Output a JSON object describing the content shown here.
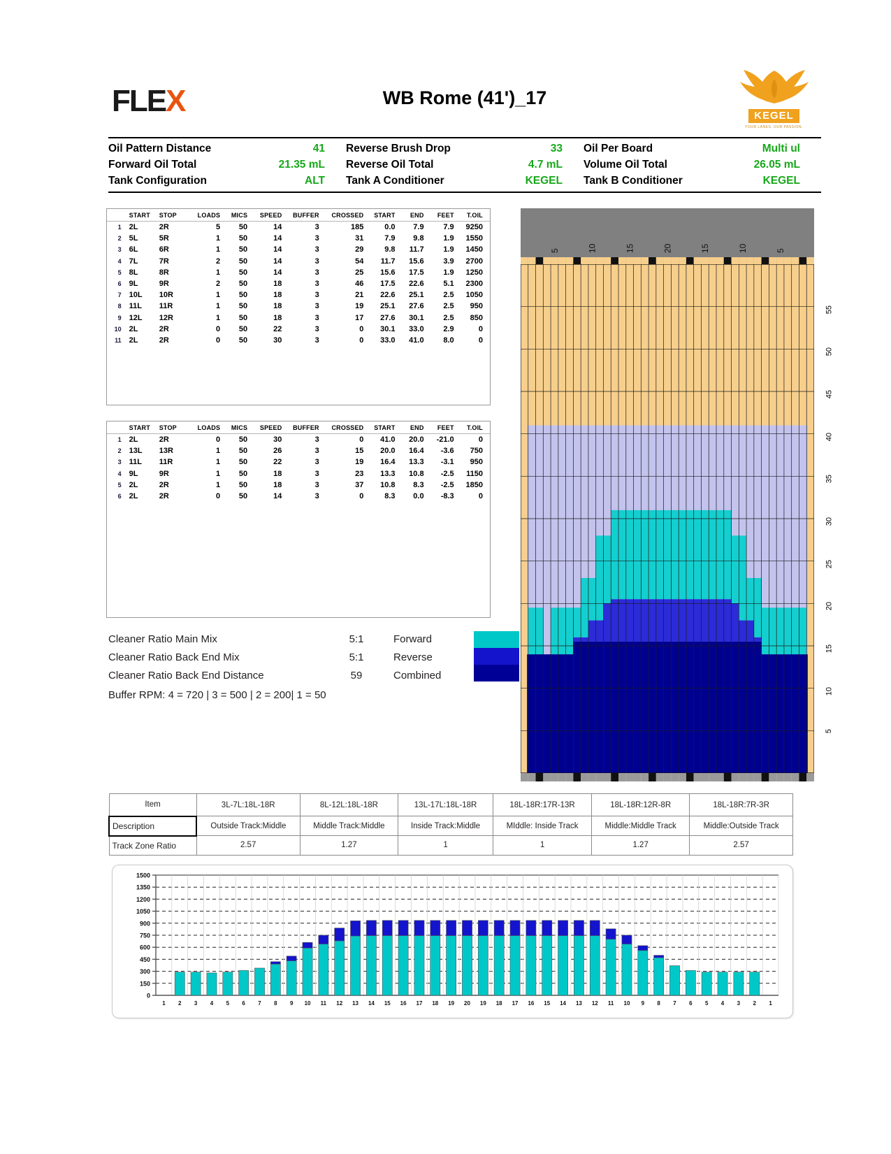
{
  "header": {
    "flex_logo_text": "FLEX",
    "title": "WB Rome (41')_17",
    "kegel_word": "KEGEL",
    "kegel_tagline": "YOUR LANES. OUR PASSION."
  },
  "summary": {
    "rows": [
      [
        {
          "label": "Oil Pattern Distance",
          "value": "41"
        },
        {
          "label": "Reverse Brush Drop",
          "value": "33"
        },
        {
          "label": "Oil Per Board",
          "value": "Multi ul"
        }
      ],
      [
        {
          "label": "Forward Oil Total",
          "value": "21.35 mL"
        },
        {
          "label": "Reverse Oil Total",
          "value": "4.7 mL"
        },
        {
          "label": "Volume Oil Total",
          "value": "26.05 mL"
        }
      ],
      [
        {
          "label": "Tank Configuration",
          "value": "ALT"
        },
        {
          "label": "Tank A Conditioner",
          "value": "KEGEL"
        },
        {
          "label": "Tank B Conditioner",
          "value": "KEGEL"
        }
      ]
    ],
    "value_color": "#17a81a"
  },
  "forward_table": {
    "columns": [
      "",
      "START",
      "STOP",
      "LOADS",
      "MICS",
      "SPEED",
      "BUFFER",
      "CROSSED",
      "START",
      "END",
      "FEET",
      "T.OIL"
    ],
    "rows": [
      [
        "1",
        "2L",
        "2R",
        "5",
        "50",
        "14",
        "3",
        "185",
        "0.0",
        "7.9",
        "7.9",
        "9250"
      ],
      [
        "2",
        "5L",
        "5R",
        "1",
        "50",
        "14",
        "3",
        "31",
        "7.9",
        "9.8",
        "1.9",
        "1550"
      ],
      [
        "3",
        "6L",
        "6R",
        "1",
        "50",
        "14",
        "3",
        "29",
        "9.8",
        "11.7",
        "1.9",
        "1450"
      ],
      [
        "4",
        "7L",
        "7R",
        "2",
        "50",
        "14",
        "3",
        "54",
        "11.7",
        "15.6",
        "3.9",
        "2700"
      ],
      [
        "5",
        "8L",
        "8R",
        "1",
        "50",
        "14",
        "3",
        "25",
        "15.6",
        "17.5",
        "1.9",
        "1250"
      ],
      [
        "6",
        "9L",
        "9R",
        "2",
        "50",
        "18",
        "3",
        "46",
        "17.5",
        "22.6",
        "5.1",
        "2300"
      ],
      [
        "7",
        "10L",
        "10R",
        "1",
        "50",
        "18",
        "3",
        "21",
        "22.6",
        "25.1",
        "2.5",
        "1050"
      ],
      [
        "8",
        "11L",
        "11R",
        "1",
        "50",
        "18",
        "3",
        "19",
        "25.1",
        "27.6",
        "2.5",
        "950"
      ],
      [
        "9",
        "12L",
        "12R",
        "1",
        "50",
        "18",
        "3",
        "17",
        "27.6",
        "30.1",
        "2.5",
        "850"
      ],
      [
        "10",
        "2L",
        "2R",
        "0",
        "50",
        "22",
        "3",
        "0",
        "30.1",
        "33.0",
        "2.9",
        "0"
      ],
      [
        "11",
        "2L",
        "2R",
        "0",
        "50",
        "30",
        "3",
        "0",
        "33.0",
        "41.0",
        "8.0",
        "0"
      ]
    ]
  },
  "reverse_table": {
    "columns": [
      "",
      "START",
      "STOP",
      "LOADS",
      "MICS",
      "SPEED",
      "BUFFER",
      "CROSSED",
      "START",
      "END",
      "FEET",
      "T.OIL"
    ],
    "rows": [
      [
        "1",
        "2L",
        "2R",
        "0",
        "50",
        "30",
        "3",
        "0",
        "41.0",
        "20.0",
        "-21.0",
        "0"
      ],
      [
        "2",
        "13L",
        "13R",
        "1",
        "50",
        "26",
        "3",
        "15",
        "20.0",
        "16.4",
        "-3.6",
        "750"
      ],
      [
        "3",
        "11L",
        "11R",
        "1",
        "50",
        "22",
        "3",
        "19",
        "16.4",
        "13.3",
        "-3.1",
        "950"
      ],
      [
        "4",
        "9L",
        "9R",
        "1",
        "50",
        "18",
        "3",
        "23",
        "13.3",
        "10.8",
        "-2.5",
        "1150"
      ],
      [
        "5",
        "2L",
        "2R",
        "1",
        "50",
        "18",
        "3",
        "37",
        "10.8",
        "8.3",
        "-2.5",
        "1850"
      ],
      [
        "6",
        "2L",
        "2R",
        "0",
        "50",
        "14",
        "3",
        "0",
        "8.3",
        "0.0",
        "-8.3",
        "0"
      ]
    ]
  },
  "ratios": {
    "items": [
      {
        "label": "Cleaner Ratio Main Mix",
        "value": "5:1",
        "direction": "Forward"
      },
      {
        "label": "Cleaner Ratio Back End Mix",
        "value": "5:1",
        "direction": "Reverse"
      },
      {
        "label": "Cleaner Ratio Back End Distance",
        "value": "59",
        "direction": "Combined"
      }
    ],
    "buffer_rpm": "Buffer RPM: 4 = 720 | 3 = 500 | 2 = 200| 1 = 50"
  },
  "legend": {
    "forward_color": "#00c8c8",
    "reverse_color": "#1414cd",
    "combined_color": "#000096"
  },
  "lane": {
    "top_scale_labels": [
      "5",
      "10",
      "15",
      "20",
      "15",
      "10",
      "5"
    ],
    "feet_labels": [
      "55",
      "50",
      "45",
      "40",
      "35",
      "30",
      "25",
      "20",
      "15",
      "10",
      "5"
    ],
    "wood_color": "#f7cf8c",
    "header_color": "#808080"
  },
  "track_zone": {
    "columns": [
      "Item",
      "3L-7L:18L-18R",
      "8L-12L:18L-18R",
      "13L-17L:18L-18R",
      "18L-18R:17R-13R",
      "18L-18R:12R-8R",
      "18L-18R:7R-3R"
    ],
    "rows": [
      {
        "label": "Description",
        "values": [
          "Outside Track:Middle",
          "Middle Track:Middle",
          "Inside Track:Middle",
          "MIddle: Inside Track",
          "Middle:Middle Track",
          "Middle:Outside Track"
        ]
      },
      {
        "label": "Track Zone Ratio",
        "values": [
          "2.57",
          "1.27",
          "1",
          "1",
          "1.27",
          "2.57"
        ]
      }
    ]
  },
  "chart_data": {
    "type": "bar",
    "stacked": true,
    "title": "",
    "xlabel": "",
    "ylabel": "",
    "ylim": [
      0,
      1500
    ],
    "yticks": [
      0,
      150,
      300,
      450,
      600,
      750,
      900,
      1050,
      1200,
      1350,
      1500
    ],
    "ytick_labels": [
      "0",
      "150",
      "300",
      "450",
      "600",
      "750",
      "900",
      "1050",
      "1200",
      "1350",
      "1500"
    ],
    "grid": true,
    "legend_position": "none",
    "categories": [
      "1",
      "2",
      "3",
      "4",
      "5",
      "6",
      "7",
      "8",
      "9",
      "10",
      "11",
      "12",
      "13",
      "14",
      "15",
      "16",
      "17",
      "18",
      "19",
      "20",
      "19",
      "18",
      "17",
      "16",
      "15",
      "14",
      "13",
      "12",
      "11",
      "10",
      "9",
      "8",
      "7",
      "6",
      "5",
      "4",
      "3",
      "2",
      "1"
    ],
    "series": [
      {
        "name": "Forward",
        "color": "#00c8c8",
        "values": [
          0,
          290,
          290,
          280,
          290,
          310,
          340,
          390,
          430,
          590,
          640,
          680,
          740,
          745,
          745,
          745,
          745,
          745,
          745,
          745,
          745,
          745,
          745,
          745,
          745,
          745,
          745,
          745,
          700,
          640,
          560,
          470,
          370,
          310,
          290,
          290,
          290,
          290,
          0
        ]
      },
      {
        "name": "Reverse",
        "color": "#1414cd",
        "values": [
          0,
          0,
          0,
          0,
          0,
          0,
          0,
          30,
          60,
          70,
          110,
          160,
          190,
          190,
          190,
          190,
          190,
          190,
          190,
          190,
          190,
          190,
          190,
          190,
          190,
          190,
          190,
          190,
          130,
          110,
          60,
          30,
          0,
          0,
          0,
          0,
          0,
          0,
          0
        ]
      }
    ]
  }
}
